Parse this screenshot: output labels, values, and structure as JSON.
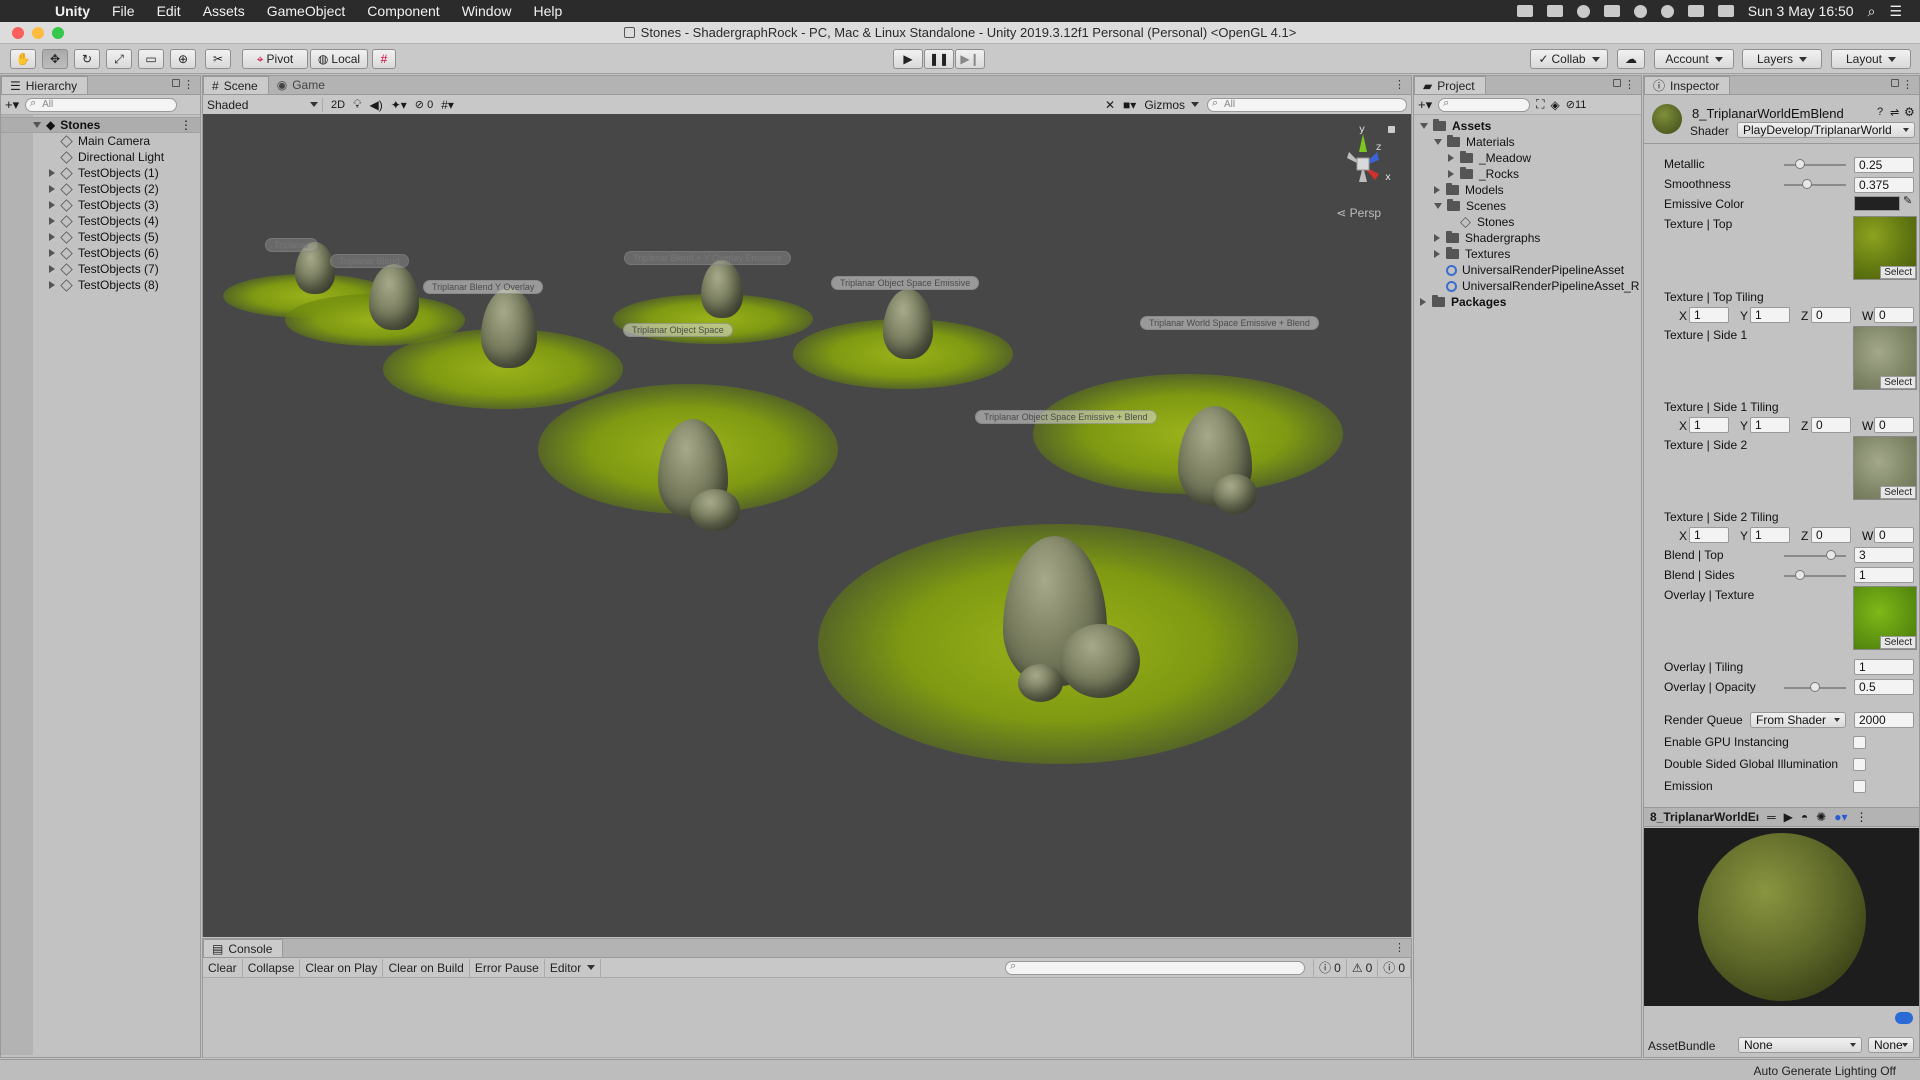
{
  "menubar": {
    "app": "Unity",
    "items": [
      "File",
      "Edit",
      "Assets",
      "GameObject",
      "Component",
      "Window",
      "Help"
    ],
    "clock": "Sun 3 May  16:50"
  },
  "window": {
    "title": "Stones - ShadergraphRock - PC, Mac & Linux Standalone - Unity 2019.3.12f1 Personal (Personal) <OpenGL 4.1>"
  },
  "toolbar": {
    "pivot": "Pivot",
    "local": "Local",
    "collab": "Collab",
    "account": "Account",
    "layers": "Layers",
    "layout": "Layout"
  },
  "hierarchy": {
    "tab": "Hierarchy",
    "search_placeholder": "All",
    "root": "Stones",
    "items": [
      "Main Camera",
      "Directional Light",
      "TestObjects (1)",
      "TestObjects (2)",
      "TestObjects (3)",
      "TestObjects (4)",
      "TestObjects (5)",
      "TestObjects (6)",
      "TestObjects (7)",
      "TestObjects (8)"
    ]
  },
  "scene": {
    "tabs": [
      "Scene",
      "Game"
    ],
    "shading": "Shaded",
    "mode_2d": "2D",
    "hidden_count": "0",
    "gizmos": "Gizmos",
    "search_placeholder": "All",
    "persp": "Persp",
    "axes": {
      "y": "y",
      "z": "z",
      "x": "x"
    },
    "labels": [
      "Triplanar",
      "Triplanar Blend",
      "Triplanar Blend Y Overlay",
      "Triplanar Blend + Y Overlay Emissive",
      "Triplanar Object Space",
      "Triplanar Object Space Emissive",
      "Triplanar World Space Emissive + Blend",
      "Triplanar Object Space Emissive + Blend"
    ]
  },
  "console": {
    "tab": "Console",
    "buttons": [
      "Clear",
      "Collapse",
      "Clear on Play",
      "Clear on Build",
      "Error Pause",
      "Editor"
    ],
    "counts": {
      "info": "0",
      "warn": "0",
      "error": "0"
    }
  },
  "project": {
    "tab": "Project",
    "count": "11",
    "tree": {
      "assets": "Assets",
      "materials": "Materials",
      "meadow": "_Meadow",
      "rocks": "_Rocks",
      "models": "Models",
      "scenes": "Scenes",
      "stones": "Stones",
      "shadergraphs": "Shadergraphs",
      "textures": "Textures",
      "urp1": "UniversalRenderPipelineAsset",
      "urp2": "UniversalRenderPipelineAsset_R",
      "packages": "Packages"
    }
  },
  "inspector": {
    "tab": "Inspector",
    "material_name": "8_TriplanarWorldEmBlend",
    "shader_label": "Shader",
    "shader_value": "PlayDevelop/TriplanarWorld",
    "metallic_label": "Metallic",
    "metallic": "0.25",
    "smoothness_label": "Smoothness",
    "smoothness": "0.375",
    "emissive_label": "Emissive Color",
    "tex_top": "Texture | Top",
    "tex_top_tiling": "Texture | Top Tiling",
    "tex_side1": "Texture | Side 1",
    "tex_side1_tiling": "Texture | Side 1 Tiling",
    "tex_side2": "Texture | Side 2",
    "tex_side2_tiling": "Texture | Side 2 Tiling",
    "tiling_top": {
      "x": "1",
      "y": "1",
      "z": "0",
      "w": "0"
    },
    "tiling_side1": {
      "x": "1",
      "y": "1",
      "z": "0",
      "w": "0"
    },
    "tiling_side2": {
      "x": "1",
      "y": "1",
      "z": "0",
      "w": "0"
    },
    "axis_letters": {
      "x": "X",
      "y": "Y",
      "z": "Z",
      "w": "W"
    },
    "select": "Select",
    "blend_top_label": "Blend | Top",
    "blend_top": "3",
    "blend_sides_label": "Blend | Sides",
    "blend_sides": "1",
    "overlay_tex_label": "Overlay | Texture",
    "overlay_tiling_label": "Overlay | Tiling",
    "overlay_tiling": "1",
    "overlay_opacity_label": "Overlay | Opacity",
    "overlay_opacity": "0.5",
    "render_queue_label": "Render Queue",
    "render_queue_mode": "From Shader",
    "render_queue": "2000",
    "gpu_instancing": "Enable GPU Instancing",
    "double_sided": "Double Sided Global Illumination",
    "emission": "Emission",
    "preview_title": "8_TriplanarWorldEı",
    "assetbundle_label": "AssetBundle",
    "assetbundle": "None",
    "assetbundle_variant": "None",
    "slider_levels": {
      "metallic": 0.25,
      "smoothness": 0.375,
      "blend_top": 0.75,
      "blend_sides": 0.25,
      "overlay_opacity": 0.5
    }
  },
  "status": "Auto Generate Lighting Off"
}
